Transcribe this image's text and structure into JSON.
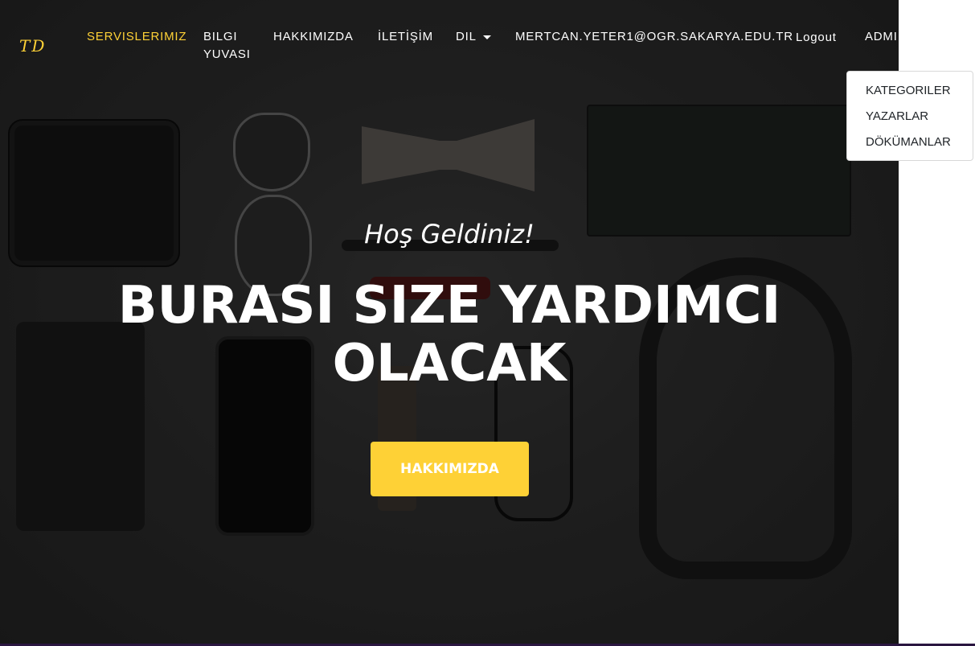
{
  "brand": {
    "logo_text": "TD"
  },
  "nav": {
    "services": "SERVISLERIMIZ",
    "knowledge": "BILGI YUVASI",
    "about": "HAKKIMIZDA",
    "contact": "İLETİŞİM",
    "language": "DIL",
    "user_email": "MERTCAN.YETER1@OGR.SAKARYA.EDU.TR",
    "logout": "Logout",
    "admin": "ADMI"
  },
  "admin_dropdown": {
    "items": [
      "KATEGORILER",
      "YAZARLAR",
      "DÖKÜMANLAR"
    ]
  },
  "hero": {
    "lead": "Hoş Geldiniz!",
    "heading": "BURASI SIZE YARDIMCI OLACAK",
    "button": "HAKKIMIZDA"
  },
  "colors": {
    "accent": "#fed136",
    "text": "#ffffff",
    "dropdown_bg": "#ffffff"
  }
}
